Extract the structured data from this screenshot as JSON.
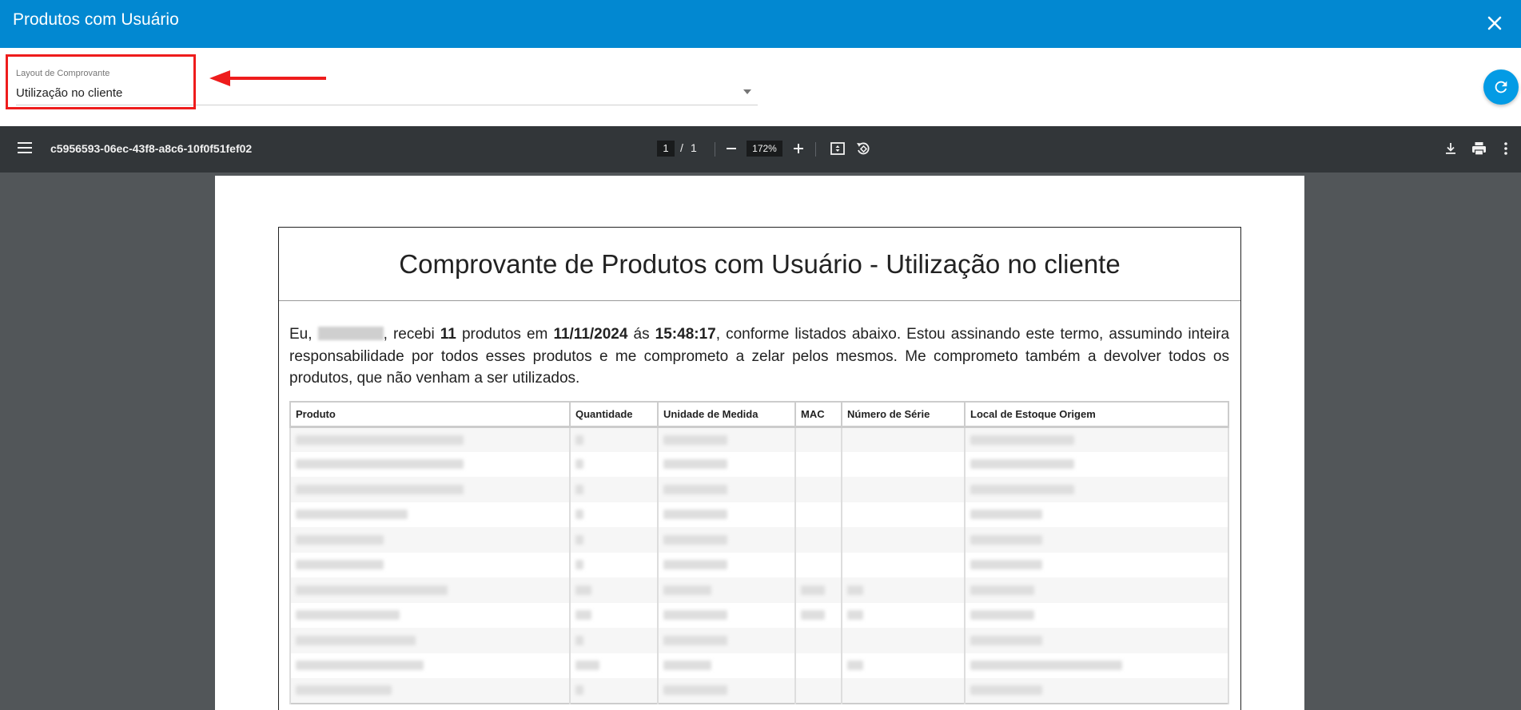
{
  "dialog": {
    "title": "Produtos com Usuário"
  },
  "layout_select": {
    "label": "Layout de Comprovante",
    "value": "Utilização no cliente"
  },
  "pdf_viewer": {
    "filename": "c5956593-06ec-43f8-a8c6-10f0f51fef02",
    "current_page": "1",
    "page_separator": "/",
    "total_pages": "1",
    "zoom": "172%"
  },
  "document": {
    "title": "Comprovante de Produtos com Usuário - Utilização no cliente",
    "para": {
      "prefix": "Eu,",
      "after_name": ", recebi",
      "count": "11",
      "after_count": "produtos em",
      "date": "11/11/2024",
      "after_date": "ás",
      "time": "15:48:17",
      "rest": ", conforme listados abaixo. Estou assinando este termo, assumindo inteira responsabilidade por todos esses produtos e me comprometo a zelar pelos mesmos. Me comprometo também a devolver todos os produtos, que não venham a ser utilizados."
    },
    "table_headers": {
      "produto": "Produto",
      "quantidade": "Quantidade",
      "unidade": "Unidade de Medida",
      "mac": "MAC",
      "serie": "Número de Série",
      "local": "Local de Estoque Origem"
    }
  },
  "colors": {
    "header_bg": "#0288d1",
    "toolbar_bg": "#323639",
    "viewer_bg": "#525659",
    "highlight": "#ee1c1c",
    "refresh_button": "#039be5"
  }
}
